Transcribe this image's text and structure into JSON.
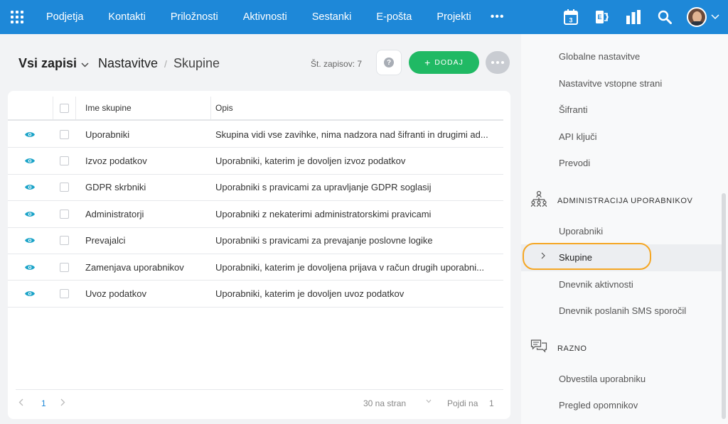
{
  "nav": {
    "items": [
      "Podjetja",
      "Kontakti",
      "Priložnosti",
      "Aktivnosti",
      "Sestanki",
      "E-pošta",
      "Projekti"
    ],
    "more": "•••",
    "calendar_day": "3"
  },
  "header": {
    "view_select": "Vsi zapisi",
    "breadcrumb_main": "Nastavitve",
    "breadcrumb_sep": "/",
    "breadcrumb_current": "Skupine",
    "record_count": "Št. zapisov: 7",
    "help_label": "?",
    "add_label": "DODAJ"
  },
  "table": {
    "columns": [
      "Ime skupine",
      "Opis"
    ],
    "rows": [
      {
        "name": "Uporabniki",
        "desc": "Skupina vidi vse zavihke, nima nadzora nad šifranti in drugimi ad..."
      },
      {
        "name": "Izvoz podatkov",
        "desc": "Uporabniki, katerim je dovoljen izvoz podatkov"
      },
      {
        "name": "GDPR skrbniki",
        "desc": "Uporabniki s pravicami za upravljanje GDPR soglasij"
      },
      {
        "name": "Administratorji",
        "desc": "Uporabniki z nekaterimi administratorskimi pravicami"
      },
      {
        "name": "Prevajalci",
        "desc": "Uporabniki s pravicami za prevajanje poslovne logike"
      },
      {
        "name": "Zamenjava uporabnikov",
        "desc": "Uporabniki, katerim je dovoljena prijava v račun drugih uporabni..."
      },
      {
        "name": "Uvoz podatkov",
        "desc": "Uporabniki, katerim je dovoljen uvoz podatkov"
      }
    ]
  },
  "footer": {
    "page": "1",
    "per_page": "30 na stran",
    "goto_label": "Pojdi na",
    "goto_value": "1"
  },
  "panel": {
    "top_items": [
      "Globalne nastavitve",
      "Nastavitve vstopne strani",
      "Šifranti",
      "API ključi",
      "Prevodi"
    ],
    "admin_section": "ADMINISTRACIJA UPORABNIKOV",
    "admin_items": [
      "Uporabniki",
      "Skupine",
      "Dnevnik aktivnosti",
      "Dnevnik poslanih SMS sporočil"
    ],
    "misc_section": "RAZNO",
    "misc_items": [
      "Obvestila uporabniku",
      "Pregled opomnikov"
    ]
  },
  "colors": {
    "topbar": "#1e88d8",
    "add_button": "#20b964",
    "highlight": "#f5a623",
    "eye_icon": "#1aa3c8"
  }
}
